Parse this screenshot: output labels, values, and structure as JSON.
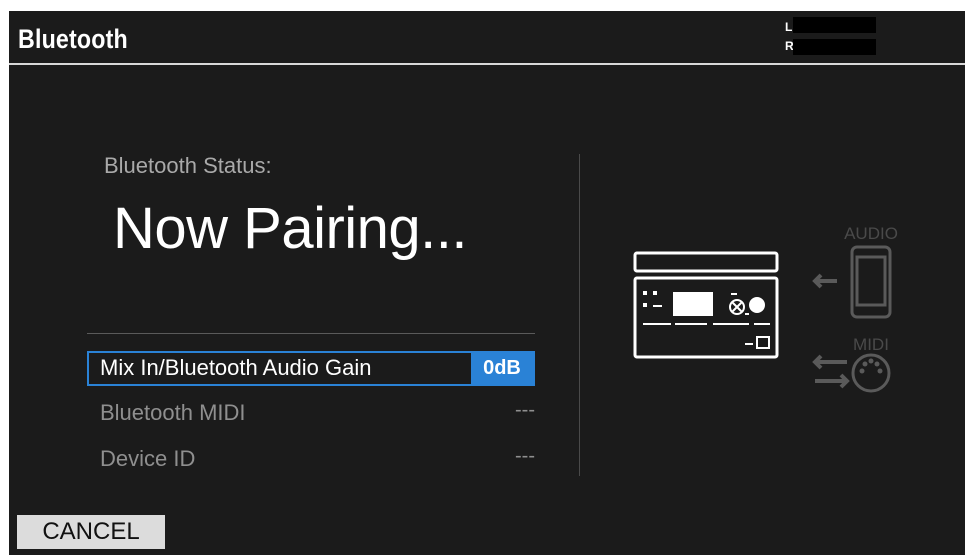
{
  "header": {
    "title": "Bluetooth",
    "meter_left_label": "L",
    "meter_right_label": "R"
  },
  "status": {
    "label": "Bluetooth Status:",
    "value": "Now Pairing..."
  },
  "params": [
    {
      "label": "Mix In/Bluetooth Audio Gain",
      "value": "0dB"
    },
    {
      "label": "Bluetooth MIDI",
      "value": "---"
    },
    {
      "label": "Device ID",
      "value": "---"
    }
  ],
  "diagram": {
    "audio_label": "AUDIO",
    "midi_label": "MIDI"
  },
  "footer": {
    "cancel_label": "CANCEL"
  },
  "colors": {
    "accent": "#2a82d6",
    "background": "#1b1b1b",
    "dim_text": "#8f8f8f"
  }
}
